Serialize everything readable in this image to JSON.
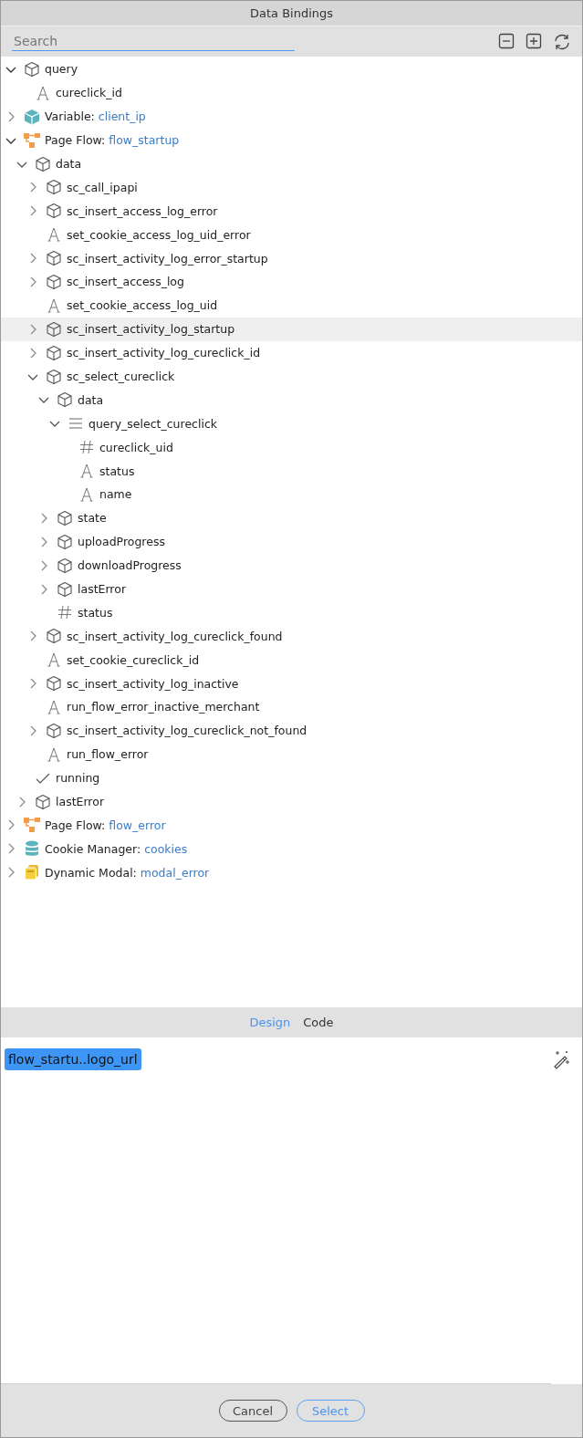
{
  "window": {
    "title": "Data Bindings"
  },
  "search": {
    "placeholder": "Search"
  },
  "toolbar": [
    {
      "kind": "collapse"
    },
    {
      "kind": "expand"
    },
    {
      "kind": "refresh"
    }
  ],
  "tree": [
    {
      "kind": "object",
      "label": "query",
      "expanded": true,
      "selected": false,
      "children": [
        {
          "kind": "string",
          "label": "cureclick_id",
          "selected": false
        }
      ]
    },
    {
      "kind": "variable",
      "label": "Variable:",
      "value": "client_ip",
      "expanded": false,
      "selected": false
    },
    {
      "kind": "flow",
      "label": "Page Flow:",
      "value": "flow_startup",
      "expanded": true,
      "selected": false,
      "children": [
        {
          "kind": "object",
          "label": "data",
          "expanded": true,
          "selected": false,
          "children": [
            {
              "kind": "object",
              "label": "sc_call_ipapi",
              "expanded": false,
              "selected": false
            },
            {
              "kind": "object",
              "label": "sc_insert_access_log_error",
              "expanded": false,
              "selected": false
            },
            {
              "kind": "string",
              "label": "set_cookie_access_log_uid_error",
              "selected": false
            },
            {
              "kind": "object",
              "label": "sc_insert_activity_log_error_startup",
              "expanded": false,
              "selected": false
            },
            {
              "kind": "object",
              "label": "sc_insert_access_log",
              "expanded": false,
              "selected": false
            },
            {
              "kind": "string",
              "label": "set_cookie_access_log_uid",
              "selected": false
            },
            {
              "kind": "object",
              "label": "sc_insert_activity_log_startup",
              "expanded": false,
              "selected": true
            },
            {
              "kind": "object",
              "label": "sc_insert_activity_log_cureclick_id",
              "expanded": false,
              "selected": false
            },
            {
              "kind": "object",
              "label": "sc_select_cureclick",
              "expanded": true,
              "selected": false,
              "children": [
                {
                  "kind": "object",
                  "label": "data",
                  "expanded": true,
                  "selected": false,
                  "children": [
                    {
                      "kind": "array",
                      "label": "query_select_cureclick",
                      "expanded": true,
                      "selected": false,
                      "children": [
                        {
                          "kind": "number",
                          "label": "cureclick_uid",
                          "selected": false
                        },
                        {
                          "kind": "string",
                          "label": "status",
                          "selected": false
                        },
                        {
                          "kind": "string",
                          "label": "name",
                          "selected": false
                        }
                      ]
                    }
                  ]
                },
                {
                  "kind": "object",
                  "label": "state",
                  "expanded": false,
                  "selected": false
                },
                {
                  "kind": "object",
                  "label": "uploadProgress",
                  "expanded": false,
                  "selected": false
                },
                {
                  "kind": "object",
                  "label": "downloadProgress",
                  "expanded": false,
                  "selected": false
                },
                {
                  "kind": "object",
                  "label": "lastError",
                  "expanded": false,
                  "selected": false
                },
                {
                  "kind": "number",
                  "label": "status",
                  "selected": false
                }
              ]
            },
            {
              "kind": "object",
              "label": "sc_insert_activity_log_cureclick_found",
              "expanded": false,
              "selected": false
            },
            {
              "kind": "string",
              "label": "set_cookie_cureclick_id",
              "selected": false
            },
            {
              "kind": "object",
              "label": "sc_insert_activity_log_inactive",
              "expanded": false,
              "selected": false
            },
            {
              "kind": "string",
              "label": "run_flow_error_inactive_merchant",
              "selected": false
            },
            {
              "kind": "object",
              "label": "sc_insert_activity_log_cureclick_not_found",
              "expanded": false,
              "selected": false
            },
            {
              "kind": "string",
              "label": "run_flow_error",
              "selected": false
            }
          ]
        },
        {
          "kind": "boolean",
          "label": "running",
          "selected": false
        },
        {
          "kind": "object",
          "label": "lastError",
          "expanded": false,
          "selected": false
        }
      ]
    },
    {
      "kind": "flow",
      "label": "Page Flow:",
      "value": "flow_error",
      "expanded": false,
      "selected": false
    },
    {
      "kind": "cookie",
      "label": "Cookie Manager:",
      "value": "cookies",
      "expanded": false,
      "selected": false
    },
    {
      "kind": "modal",
      "label": "Dynamic Modal:",
      "value": "modal_error",
      "expanded": false,
      "selected": false
    }
  ],
  "editor_tabs": [
    {
      "label": "Design",
      "selected": true
    },
    {
      "label": "Code",
      "selected": false
    }
  ],
  "editor": {
    "token": "flow_startu..logo_url"
  },
  "buttons": [
    {
      "label": "Cancel",
      "kind": "secondary"
    },
    {
      "label": "Select",
      "kind": "primary"
    }
  ]
}
